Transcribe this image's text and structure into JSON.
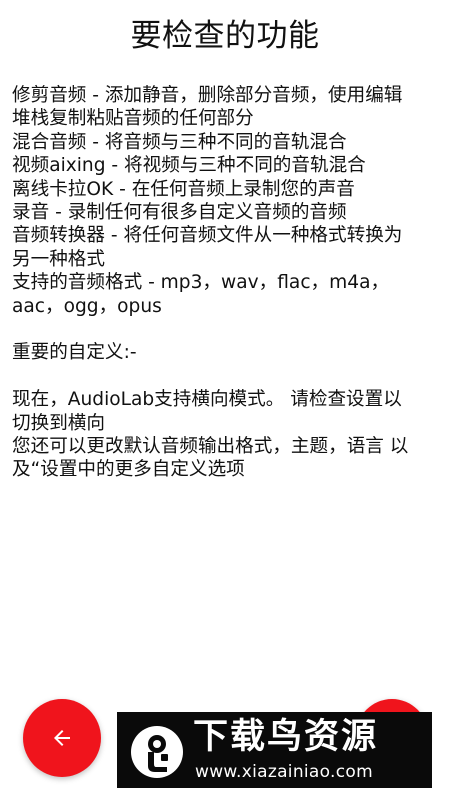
{
  "header": {
    "title": "要检查的功能"
  },
  "content": {
    "lines": [
      "修剪音频 - 添加静音，删除部分音频，使用编辑",
      "堆栈复制粘贴音频的任何部分",
      "混合音频 - 将音频与三种不同的音轨混合",
      "视频aixing - 将视频与三种不同的音轨混合",
      "离线卡拉OK - 在任何音频上录制您的声音",
      "录音 - 录制任何有很多自定义音频的音频",
      "音频转换器 - 将任何音频文件从一种格式转换为",
      "另一种格式",
      "支持的音频格式 - mp3，wav，flac，m4a，",
      "aac，ogg，opus",
      "",
      "重要的自定义:-",
      "",
      "现在，AudioLab支持横向模式。 请检查设置以",
      "切换到横向",
      "您还可以更改默认音频输出格式，主题，语言 以",
      "及“设置中的更多自定义选项"
    ]
  },
  "buttons": {
    "back_icon": "arrow-left-icon",
    "next_icon": "arrow-right-icon",
    "accent_color": "#f0141c"
  },
  "watermark": {
    "logo_icon": "bird-logo",
    "title": "下载鸟资源",
    "url": "www.xiazainiao.com"
  }
}
